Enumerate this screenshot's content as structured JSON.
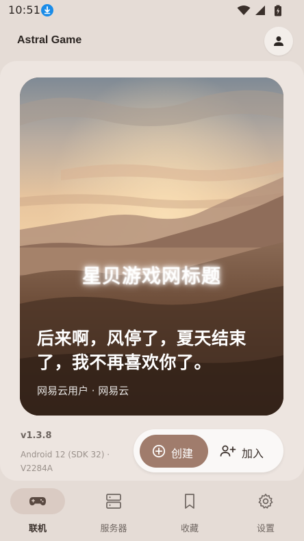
{
  "status_bar": {
    "time": "10:51",
    "icons": [
      "download-icon",
      "wifi-icon",
      "signal-icon",
      "battery-icon"
    ]
  },
  "app_bar": {
    "title": "Astral Game",
    "profile_icon": "person-icon"
  },
  "hero": {
    "overlay_text": "星贝游戏网标题",
    "lyric": "后来啊，风停了，夏天结束了，我不再喜欢你了。",
    "source": "网易云用户 · 网易云"
  },
  "info": {
    "version": "v1.3.8",
    "device": "Android 12 (SDK 32) · V2284A"
  },
  "actions": {
    "create_label": "创建",
    "join_label": "加入"
  },
  "bottom_nav": {
    "items": [
      {
        "label": "联机",
        "icon": "gamepad-icon",
        "active": true
      },
      {
        "label": "服务器",
        "icon": "server-icon",
        "active": false
      },
      {
        "label": "收藏",
        "icon": "bookmark-icon",
        "active": false
      },
      {
        "label": "设置",
        "icon": "gear-icon",
        "active": false
      }
    ]
  },
  "colors": {
    "background": "#e5dcd6",
    "surface": "#ede5e0",
    "accent": "#a07c6c",
    "nav_indicator": "#dacbc3"
  }
}
